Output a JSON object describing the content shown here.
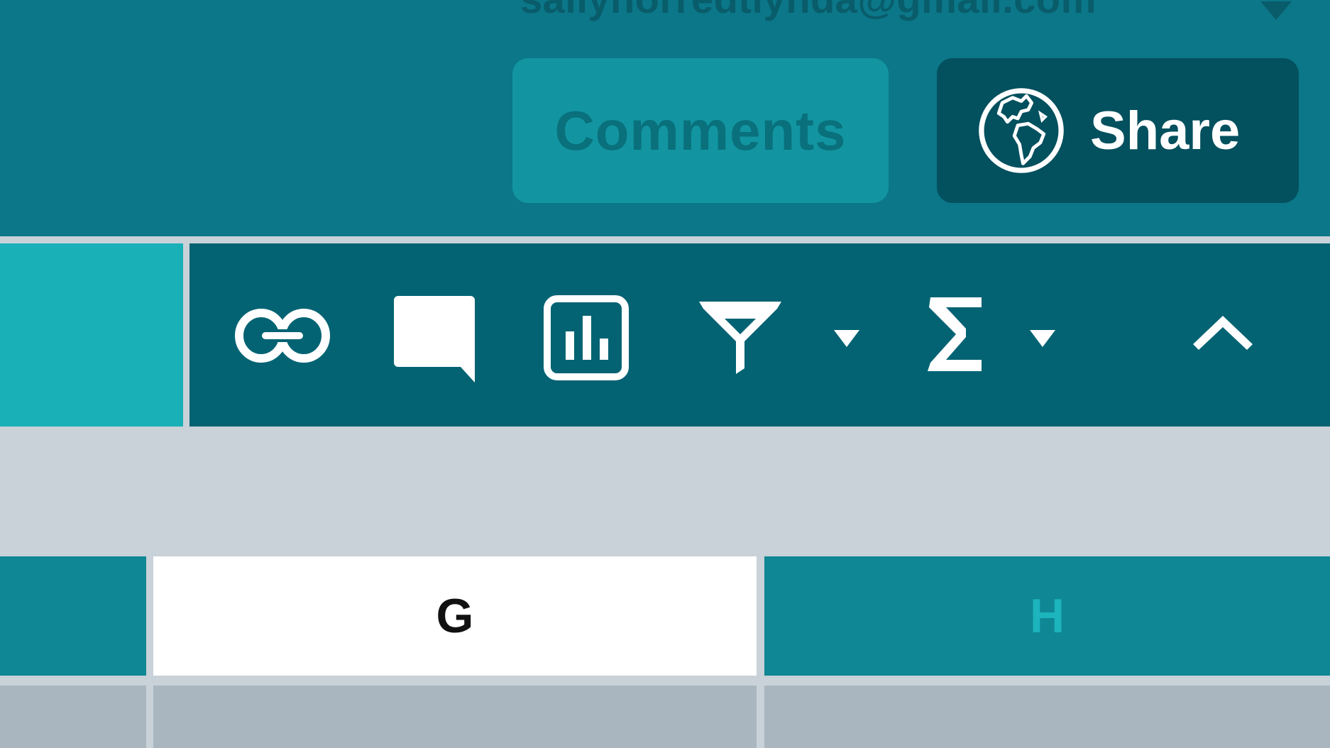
{
  "header": {
    "account_email": "sallyhorredtlynda@gmail.com",
    "comments_label": "Comments",
    "share_label": "Share"
  },
  "ribbon": {
    "tools": [
      {
        "name": "link-icon"
      },
      {
        "name": "comment-icon"
      },
      {
        "name": "chart-icon"
      },
      {
        "name": "filter-icon"
      },
      {
        "name": "filter-dropdown-icon"
      },
      {
        "name": "autosum-icon"
      },
      {
        "name": "autosum-dropdown-icon"
      },
      {
        "name": "collapse-ribbon-icon"
      }
    ]
  },
  "grid": {
    "columns": [
      "G",
      "H"
    ]
  },
  "colors": {
    "header_bg": "#0b7788",
    "ribbon_bg": "#036373",
    "share_bg": "#03505e",
    "comments_bg": "#1295a0",
    "selected_column_bg": "#ffffff",
    "column_header_bg": "#0f8794",
    "accent": "#19b0b8"
  }
}
